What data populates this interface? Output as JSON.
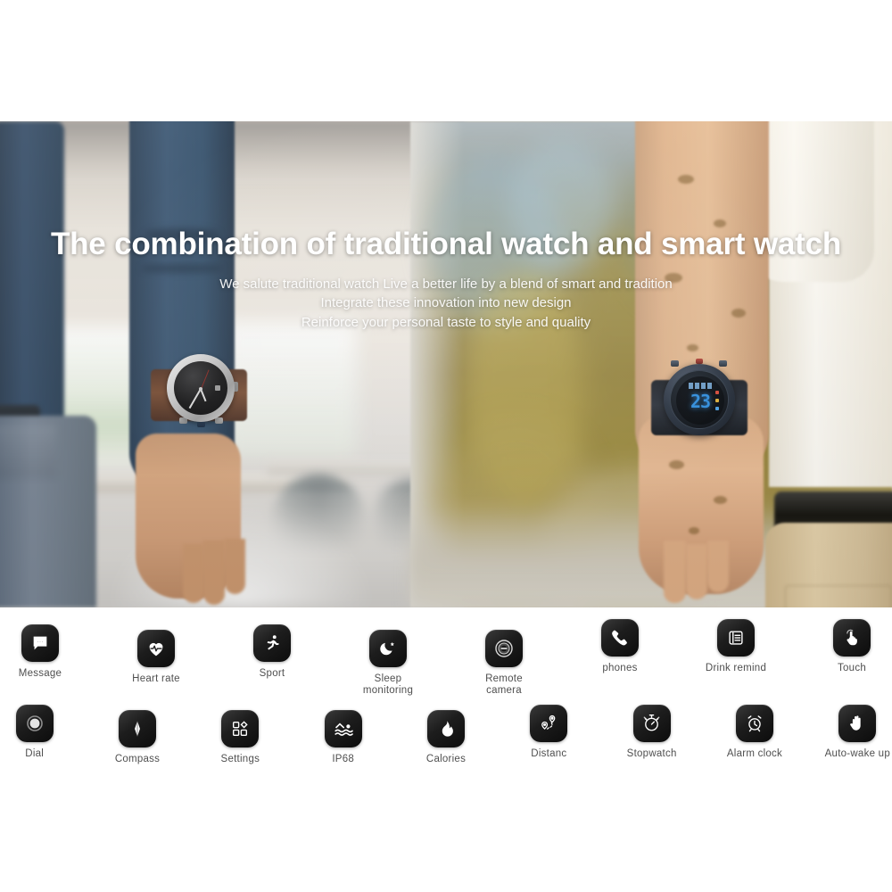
{
  "hero": {
    "title": "The combination of traditional watch and smart watch",
    "subtitle_lines": [
      "We salute traditional watch  Live a better life by a blend of smart and tradition",
      "Integrate these innovation into new design",
      "Reinforce your personal taste to style and quality"
    ],
    "left_watch": {
      "type": "traditional-analog-watch",
      "case_color": "#c8c8c8",
      "dial_color": "#101011",
      "strap_color": "#6a4430"
    },
    "right_watch": {
      "type": "digital-smart-watch",
      "case_color": "#1d252f",
      "display_color": "#2f8fe0",
      "display_time": "23"
    }
  },
  "features": {
    "row1": [
      {
        "label": "Message",
        "icon": "message-bubble-icon"
      },
      {
        "label": "Heart rate",
        "icon": "heart-pulse-icon"
      },
      {
        "label": "Sport",
        "icon": "running-person-icon"
      },
      {
        "label": "Sleep\nmonitoring",
        "icon": "moon-star-icon"
      },
      {
        "label": "Remote\ncamera",
        "icon": "camera-lens-icon"
      },
      {
        "label": "phones",
        "icon": "phone-handset-icon"
      },
      {
        "label": "Drink remind",
        "icon": "water-glass-icon"
      },
      {
        "label": "Touch",
        "icon": "touch-hand-icon"
      }
    ],
    "row2": [
      {
        "label": "Dial",
        "icon": "dial-circle-icon"
      },
      {
        "label": "Compass",
        "icon": "compass-needle-icon"
      },
      {
        "label": "Settings",
        "icon": "app-grid-icon"
      },
      {
        "label": "IP68",
        "icon": "water-waves-icon"
      },
      {
        "label": "Calories",
        "icon": "flame-icon"
      },
      {
        "label": "Distanc",
        "icon": "map-pin-route-icon"
      },
      {
        "label": "Stopwatch",
        "icon": "stopwatch-icon"
      },
      {
        "label": "Alarm clock",
        "icon": "alarm-clock-icon"
      },
      {
        "label": "Auto-wake up",
        "icon": "raised-hand-icon"
      }
    ]
  },
  "colors": {
    "tile_dark": "#1d1d1d",
    "label_gray": "#4f4f4f",
    "hero_text": "#ffffff",
    "page_background": "#ffffff"
  }
}
